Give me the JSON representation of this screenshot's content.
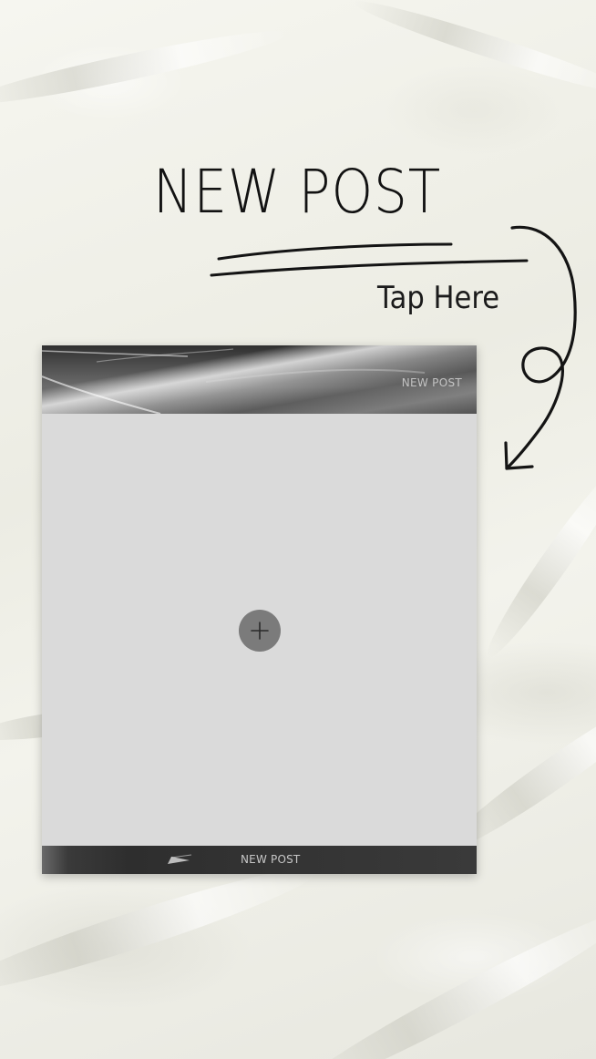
{
  "headline": "NEW POST",
  "cta": "Tap Here",
  "mock_post": {
    "header_label": "NEW POST",
    "footer_label": "NEW POST",
    "add_icon": "plus-icon"
  },
  "colors": {
    "background": "#efefe7",
    "text": "#121212",
    "placeholder": "#dadada",
    "add_button": "#7b7b7b",
    "bar_dark": "#2e2e2e"
  },
  "icons": [
    "arrow-doodle-icon",
    "underline-doodle-icon",
    "plus-icon",
    "swoosh-icon"
  ]
}
